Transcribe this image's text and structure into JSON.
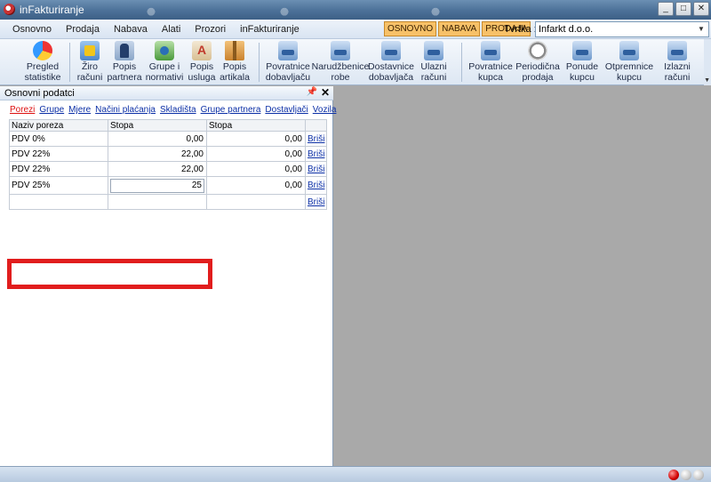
{
  "window": {
    "title": "inFakturiranje",
    "controls": [
      "_",
      "□",
      "✕"
    ]
  },
  "menu": {
    "items": [
      "Osnovno",
      "Prodaja",
      "Nabava",
      "Alati",
      "Prozori",
      "inFakturiranje"
    ],
    "quick_buttons": [
      "OSNOVNO",
      "NABAVA",
      "PRODAJA"
    ],
    "company_label": "Tvrtka :",
    "company_value": "Infarkt d.o.o."
  },
  "toolbar": {
    "items": [
      {
        "label": "Pregled\nstatistike",
        "icon": "chart-icon"
      },
      {
        "label": "Žiro\nračuni",
        "icon": "folder-icon"
      },
      {
        "label": "Popis\npartnera",
        "icon": "people-icon"
      },
      {
        "label": "Grupe i\nnormativi",
        "icon": "gears-icon"
      },
      {
        "label": "Popis\nusluga",
        "icon": "paint-icon"
      },
      {
        "label": "Popis\nartikala",
        "icon": "box-icon"
      },
      {
        "label": "Povratnice\ndobavljaču",
        "icon": "cube-icon"
      },
      {
        "label": "Narudžbenice\nrobe",
        "icon": "cube-icon"
      },
      {
        "label": "Dostavnice\ndobavljača",
        "icon": "cube-icon"
      },
      {
        "label": "Ulazni\nračuni",
        "icon": "cube-icon"
      },
      {
        "label": "Povratnice\nkupca",
        "icon": "cube-icon"
      },
      {
        "label": "Periodična\nprodaja",
        "icon": "clock-icon"
      },
      {
        "label": "Ponude\nkupcu",
        "icon": "cube-icon"
      },
      {
        "label": "Otpremnice\nkupcu",
        "icon": "cube-icon"
      },
      {
        "label": "Izlazni\nračuni",
        "icon": "cube-icon"
      }
    ]
  },
  "panel": {
    "title": "Osnovni podatci",
    "pin": "📌",
    "close": "✕",
    "links": [
      "Porezi",
      "Grupe",
      "Mjere",
      "Načini plaćanja",
      "Skladišta",
      "Grupe partnera",
      "Dostavljači",
      "Vozila"
    ],
    "grid": {
      "headers": [
        "Naziv poreza",
        "Stopa",
        "Stopa",
        ""
      ],
      "rows": [
        {
          "name": "PDV 0%",
          "rate1": "0,00",
          "rate2": "0,00",
          "action": "Briši"
        },
        {
          "name": "PDV 22%",
          "rate1": "22,00",
          "rate2": "0,00",
          "action": "Briši"
        },
        {
          "name": "PDV 22%",
          "rate1": "22,00",
          "rate2": "0,00",
          "action": "Briši"
        }
      ],
      "editing_row": {
        "name": "PDV 25%",
        "rate1": "25",
        "rate2": "0,00",
        "action": "Briši"
      },
      "empty_row_action": "Briši"
    }
  },
  "colors": {
    "highlight": "#e11d1d",
    "quick_button": "#f7c168",
    "link": "#0b2fa6"
  }
}
